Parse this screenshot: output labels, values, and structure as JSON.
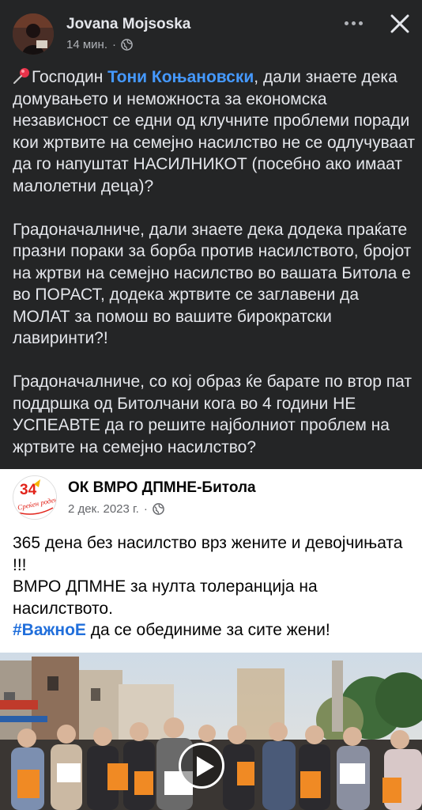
{
  "post": {
    "author": "Jovana Mojsoska",
    "time": "14 мин.",
    "separator": "·",
    "mention": "Тони Коњановски",
    "para1_before": "Господин ",
    "para1_after": ", дали знаете дека домувањето и неможноста за економска независност се едни од клучните проблеми поради кои жртвите на семејно насилство не се одлучуваат да го напуштат НАСИЛНИКОТ (посебно ако имаат малолетни деца)?",
    "para2": "Градоначалниче, дали знаете дека додека праќате празни пораки за борба против насилството, бројот на жртви на семејно насилство во вашата Битола е во ПОРАСТ, додека жртвите се заглавени да МОЛАТ за помош во вашите бирократски лавиринти?!",
    "para3": "Градоначалниче, со кој образ ќе барате по втор пат поддршка од Битолчани кога во 4 години НЕ УСПЕАВТЕ да го решите најболниот проблем на жртвите на семејно насилство?"
  },
  "shared": {
    "page_name": "ОК ВМРО ДПМНЕ-Битола",
    "date": "2 дек. 2023 г.",
    "separator": "·",
    "logo_number": "34",
    "logo_text": "Среќен роденден!",
    "line1": "365 дена без насилство врз жените и девојчињата !!!",
    "line2": "ВМРО ДПМНЕ за нулта толеранција на насилството.",
    "hashtag": "#ВажноЕ",
    "line3_rest": " да се обединиме за сите жени!"
  },
  "colors": {
    "background": "#242526",
    "mention": "#4599ff",
    "hashtag": "#216fdb",
    "logo_red": "#e2231a"
  },
  "icons": [
    "pushpin-icon",
    "globe-icon",
    "more-icon",
    "close-icon",
    "play-icon"
  ]
}
